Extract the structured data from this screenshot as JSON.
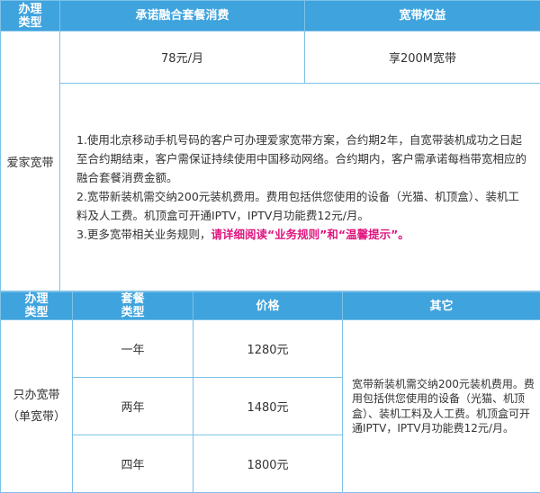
{
  "table1": {
    "headers": [
      "办理\n类型",
      "承诺融合套餐消费",
      "宽带权益"
    ],
    "row_label": "爱家宽带",
    "fee": "78元/月",
    "bandwidth": "享200M宽带",
    "rules": [
      "1.使用北京移动手机号码的客户可办理爱家宽带方案，合约期2年，自宽带装机成功之日起至合约期结束，客户需保证持续使用中国移动网络。合约期内，客户需承诺每档带宽相应的融合套餐消费金额。",
      "2.宽带新装机需交纳200元装机费用。费用包括供您使用的设备（光猫、机顶盒）、装机工料及人工费。机顶盒可开通IPTV，IPTV月功能费12元/月。"
    ],
    "rule3_prefix": "3.更多宽带相关业务规则，",
    "rule3_highlight": "请详细阅读“业务规则”和“温馨提示”。",
    "highlight_color": "#e0147e"
  },
  "table2": {
    "headers": [
      "办理\n类型",
      "套餐\n类型",
      "价格",
      "其它"
    ],
    "row_label_line1": "只办宽带",
    "row_label_line2": "（单宽带）",
    "rows": [
      {
        "term": "一年",
        "price": "1280元"
      },
      {
        "term": "两年",
        "price": "1480元"
      },
      {
        "term": "四年",
        "price": "1800元"
      }
    ],
    "other": "宽带新装机需交纳200元装机费用。费用包括供您使用的设备（光猫、机顶盒）、装机工料及人工费。机顶盒可开通IPTV，IPTV月功能费12元/月。"
  },
  "colors": {
    "header_bg": "#3fa3dd",
    "border": "#7dc2e8",
    "accent": "#e0147e"
  }
}
